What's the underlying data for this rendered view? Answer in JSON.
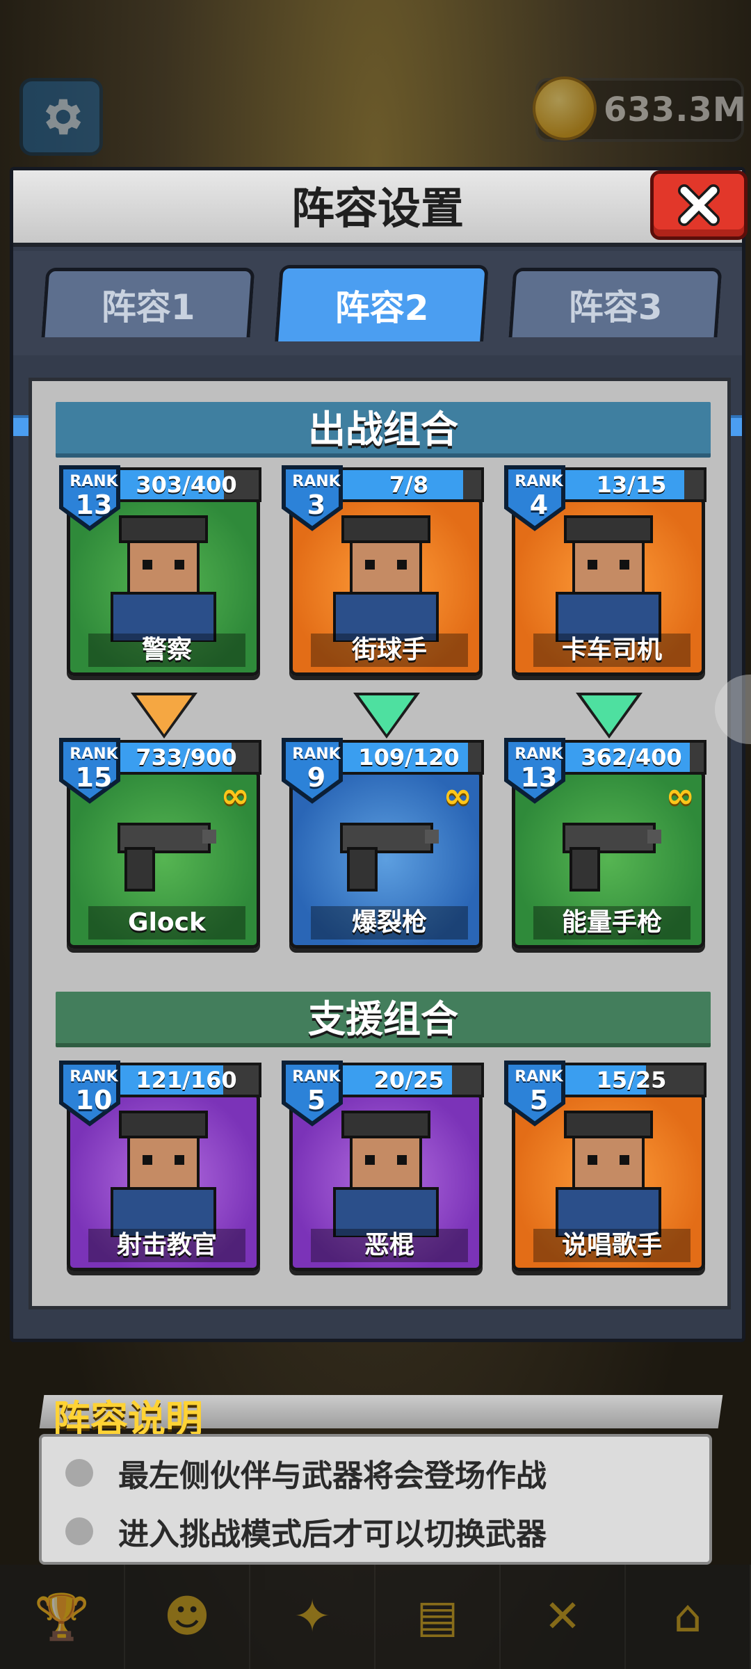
{
  "currency": {
    "value": "633.3M",
    "icon": "coin-icon"
  },
  "panel": {
    "title": "阵容设置",
    "close_icon": "close-icon"
  },
  "tabs": [
    {
      "label": "阵容1",
      "active": false
    },
    {
      "label": "阵容2",
      "active": true
    },
    {
      "label": "阵容3",
      "active": false
    }
  ],
  "sections": {
    "battle": "出战组合",
    "support": "支援组合"
  },
  "battle_characters": [
    {
      "name": "警察",
      "rank_label": "RANK",
      "rank": "13",
      "progress": "303/400",
      "ratio": 0.7575,
      "bg": "green"
    },
    {
      "name": "街球手",
      "rank_label": "RANK",
      "rank": "3",
      "progress": "7/8",
      "ratio": 0.875,
      "bg": "orange"
    },
    {
      "name": "卡车司机",
      "rank_label": "RANK",
      "rank": "4",
      "progress": "13/15",
      "ratio": 0.8667,
      "bg": "orange"
    }
  ],
  "weapons": [
    {
      "name": "Glock",
      "rank_label": "RANK",
      "rank": "15",
      "progress": "733/900",
      "ratio": 0.8144,
      "bg": "green",
      "ammo": "∞"
    },
    {
      "name": "爆裂枪",
      "rank_label": "RANK",
      "rank": "9",
      "progress": "109/120",
      "ratio": 0.9083,
      "bg": "blue",
      "ammo": "∞"
    },
    {
      "name": "能量手枪",
      "rank_label": "RANK",
      "rank": "13",
      "progress": "362/400",
      "ratio": 0.905,
      "bg": "green",
      "ammo": "∞"
    }
  ],
  "support_characters": [
    {
      "name": "射击教官",
      "rank_label": "RANK",
      "rank": "10",
      "progress": "121/160",
      "ratio": 0.7563,
      "bg": "purple"
    },
    {
      "name": "恶棍",
      "rank_label": "RANK",
      "rank": "5",
      "progress": "20/25",
      "ratio": 0.8,
      "bg": "purple"
    },
    {
      "name": "说唱歌手",
      "rank_label": "RANK",
      "rank": "5",
      "progress": "15/25",
      "ratio": 0.6,
      "bg": "orange"
    }
  ],
  "arrows": [
    "orange",
    "green",
    "green"
  ],
  "info": {
    "title": "阵容说明",
    "lines": [
      "最左侧伙伴与武器将会登场作战",
      "进入挑战模式后才可以切换武器"
    ]
  },
  "nav": [
    "trophy-icon",
    "team-icon",
    "weapon-icon",
    "book-icon",
    "battle-icon",
    "shop-icon"
  ]
}
